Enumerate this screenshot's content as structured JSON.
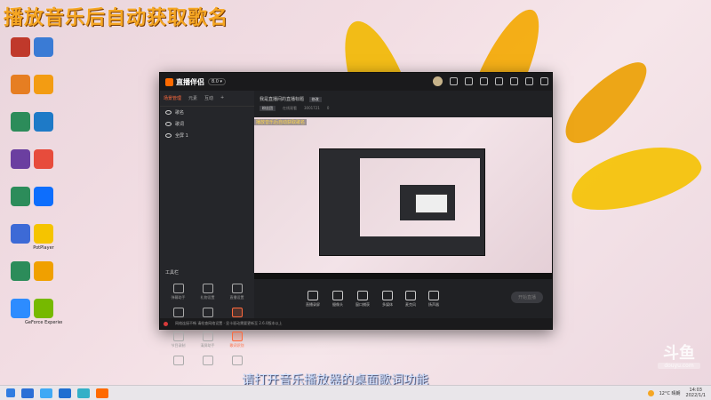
{
  "overlay_title": "播放音乐后自动获取歌名",
  "subtitle": "请打开音乐播放器的桌面歌词功能",
  "watermark": {
    "big": "斗鱼",
    "small": "douyu.com"
  },
  "desktop_icons": [
    {
      "label": "",
      "color": "#c0392b"
    },
    {
      "label": "",
      "color": "#e67e22"
    },
    {
      "label": "",
      "color": "#2c8c5a"
    },
    {
      "label": "",
      "color": "#6b3fa0"
    },
    {
      "label": "",
      "color": "#2c8c5a"
    },
    {
      "label": "",
      "color": "#3d6ad6"
    },
    {
      "label": "",
      "color": "#2c8c5a"
    },
    {
      "label": "",
      "color": "#2d8cff"
    },
    {
      "label": "",
      "color": "#3a7bd5"
    },
    {
      "label": "",
      "color": "#f39c12"
    },
    {
      "label": "",
      "color": "#1e7ac7"
    },
    {
      "label": "",
      "color": "#e74c3c"
    },
    {
      "label": "",
      "color": "#0d6efd"
    },
    {
      "label": "PotPlayer",
      "color": "#f5c400"
    },
    {
      "label": "",
      "color": "#f0a000"
    },
    {
      "label": "GeForce Experience",
      "color": "#76b900"
    }
  ],
  "app": {
    "title": "直播伴侣",
    "version": "8.0 ▾",
    "tabs": [
      "场景管理",
      "元素",
      "互动",
      "+"
    ],
    "scenes": [
      "歌名",
      "歌词",
      "全屏 1"
    ],
    "tools_title": "工具栏",
    "tools": [
      {
        "label": "弹幕助手",
        "orange": false
      },
      {
        "label": "礼物设置",
        "orange": false
      },
      {
        "label": "直播设置",
        "orange": false
      },
      {
        "label": "视频连麦",
        "orange": false
      },
      {
        "label": "多人连麦",
        "orange": false
      },
      {
        "label": "游戏中心",
        "orange": true
      },
      {
        "label": "节目录制",
        "orange": false
      },
      {
        "label": "清屏助手",
        "orange": false
      },
      {
        "label": "歌词识别",
        "orange": true
      },
      {
        "label": "",
        "orange": false
      },
      {
        "label": "",
        "orange": false
      },
      {
        "label": "",
        "orange": false
      }
    ],
    "room_title": "我是直播间的直播标题",
    "room_edit": "修改",
    "room_meta": [
      "粉丝团",
      "在线观看",
      "3001721",
      "0"
    ],
    "inner_overlay_title": "播放音乐后自动获取歌名",
    "bottom_tools": [
      "直播录屏",
      "摄像头",
      "窗口捕获",
      "多媒体",
      "麦克风",
      "扬声器"
    ],
    "start_button": "开始直播",
    "status_text": "网络连接不畅 请检查网络设置 · 显卡驱动需要更新至 2.6.0版本以上"
  },
  "taskbar": {
    "items": [
      "#2a6fd6",
      "#3fa9f5",
      "#1f6fd1",
      "#33b0c7",
      "#ff6a00"
    ],
    "weather": "12°C 晴朗",
    "time": "14:03",
    "date": "2022/1/1"
  }
}
